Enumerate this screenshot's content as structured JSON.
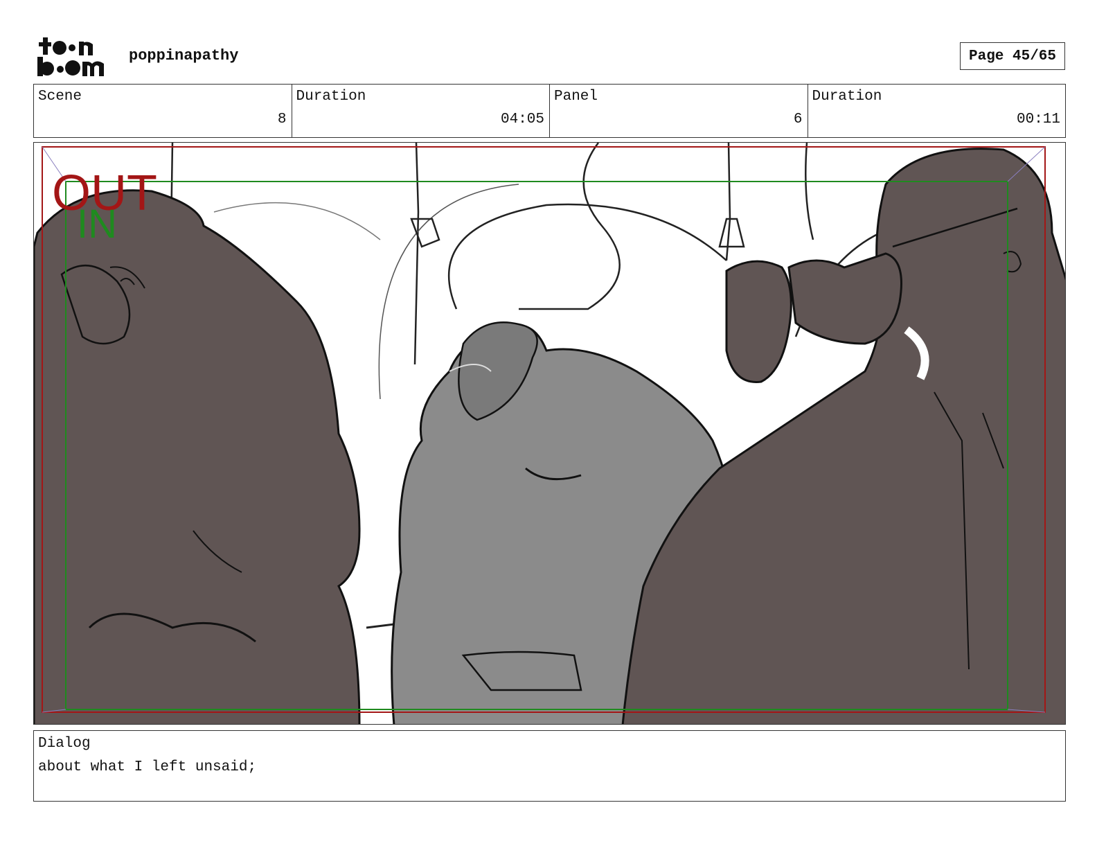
{
  "header": {
    "logo_text": "toonboom",
    "project_name": "poppinapathy",
    "page_label": "Page 45/65"
  },
  "info": {
    "scene_label": "Scene",
    "scene_value": "8",
    "scene_duration_label": "Duration",
    "scene_duration_value": "04:05",
    "panel_label": "Panel",
    "panel_value": "6",
    "panel_duration_label": "Duration",
    "panel_duration_value": "00:11"
  },
  "frame": {
    "out_label": "OUT",
    "in_label": "IN",
    "colors": {
      "out": "#a31616",
      "in": "#1f8a1f",
      "figure_dark": "#605554",
      "figure_light": "#8b8b8b"
    }
  },
  "dialog": {
    "label": "Dialog",
    "text": "about what I left unsaid;"
  }
}
